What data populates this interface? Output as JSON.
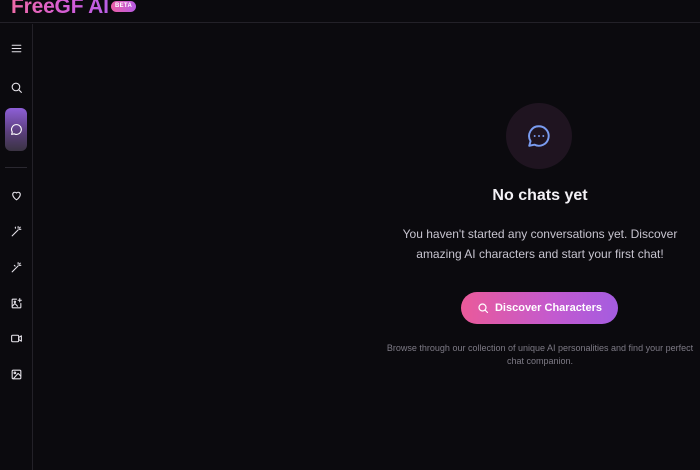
{
  "app": {
    "logo_text": "FreeGF AI",
    "beta_badge": "BETA",
    "accent_color": "#d45ad4"
  },
  "sidebar": {
    "items": [
      {
        "icon": "menu-icon",
        "label": "Menu"
      },
      {
        "icon": "search-icon",
        "label": "Search"
      },
      {
        "icon": "chat-icon",
        "label": "Chats",
        "active": true
      },
      {
        "icon": "heart-icon",
        "label": "Favorites"
      },
      {
        "icon": "magic-wand-icon",
        "label": "Create"
      },
      {
        "icon": "magic-wand-icon",
        "label": "Generate"
      },
      {
        "icon": "image-edit-icon",
        "label": "Image Edit"
      },
      {
        "icon": "video-icon",
        "label": "Video"
      },
      {
        "icon": "image-icon",
        "label": "Images"
      }
    ]
  },
  "empty_state": {
    "icon": "chat-bubble-dots-icon",
    "title": "No chats yet",
    "description": "You haven't started any conversations yet. Discover amazing AI characters and start your first chat!",
    "button_label": "Discover Characters",
    "button_icon": "search-icon",
    "hint": "Browse through our collection of unique AI personalities and find your perfect chat companion."
  }
}
